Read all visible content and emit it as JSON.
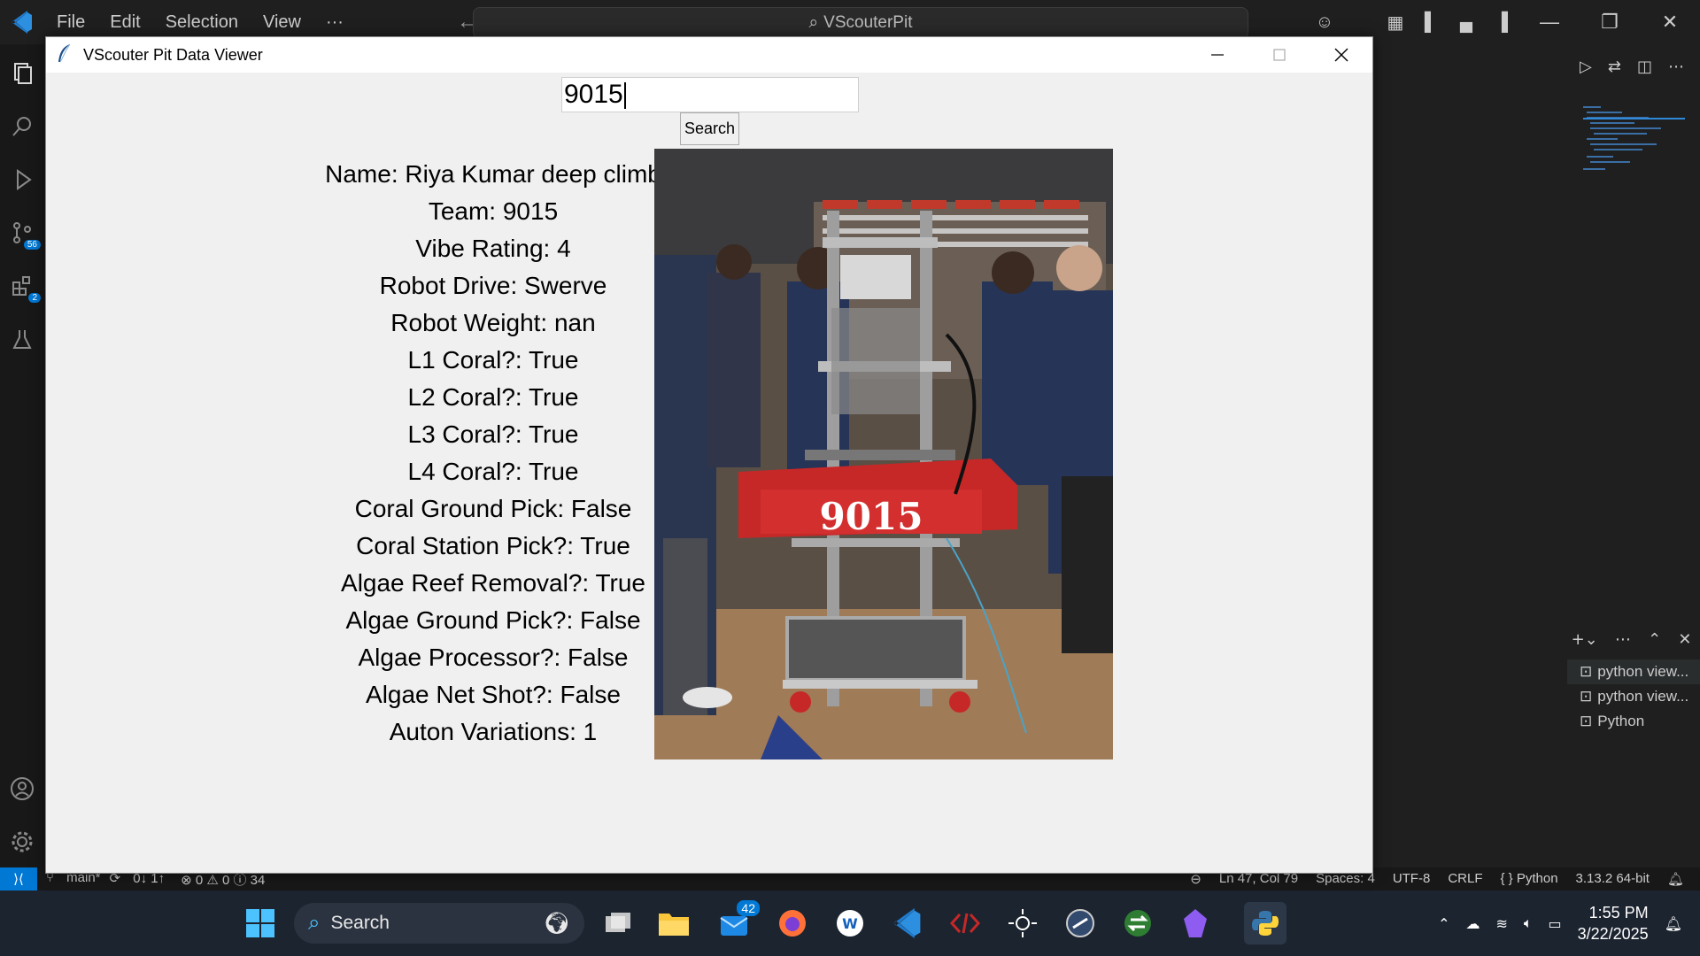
{
  "vscode": {
    "menu": [
      "File",
      "Edit",
      "Selection",
      "View",
      "···"
    ],
    "command_center": "VScouterPit",
    "badges": {
      "source_control": "56",
      "extensions": "2"
    },
    "terminals": [
      "python  view...",
      "python  view...",
      "Python"
    ],
    "status": {
      "branch": "main*",
      "sync": "0↓ 1↑",
      "problems": "⊗ 0 ⚠ 0 ⓘ 34",
      "position": "Ln 47, Col 79",
      "spaces": "Spaces: 4",
      "encoding": "UTF-8",
      "eol": "CRLF",
      "language": "{ } Python",
      "interpreter": "3.13.2 64-bit"
    }
  },
  "app": {
    "window_title": "VScouter Pit Data Viewer",
    "search_value": "9015",
    "search_button": "Search",
    "photo_label": "9015",
    "fields": [
      "Name: Riya Kumar deep climb",
      "Team: 9015",
      "Vibe Rating: 4",
      "Robot Drive: Swerve",
      "Robot Weight: nan",
      "L1 Coral?: True",
      "L2 Coral?: True",
      "L3 Coral?: True",
      "L4 Coral?: True",
      "Coral Ground Pick: False",
      "Coral Station Pick?: True",
      "Algae Reef Removal?: True",
      "Algae Ground Pick?: False",
      "Algae Processor?: False",
      "Algae Net Shot?: False",
      "Auton Variations: 1"
    ]
  },
  "taskbar": {
    "search_placeholder": "Search",
    "mail_badge": "42",
    "time": "1:55 PM",
    "date": "3/22/2025"
  }
}
